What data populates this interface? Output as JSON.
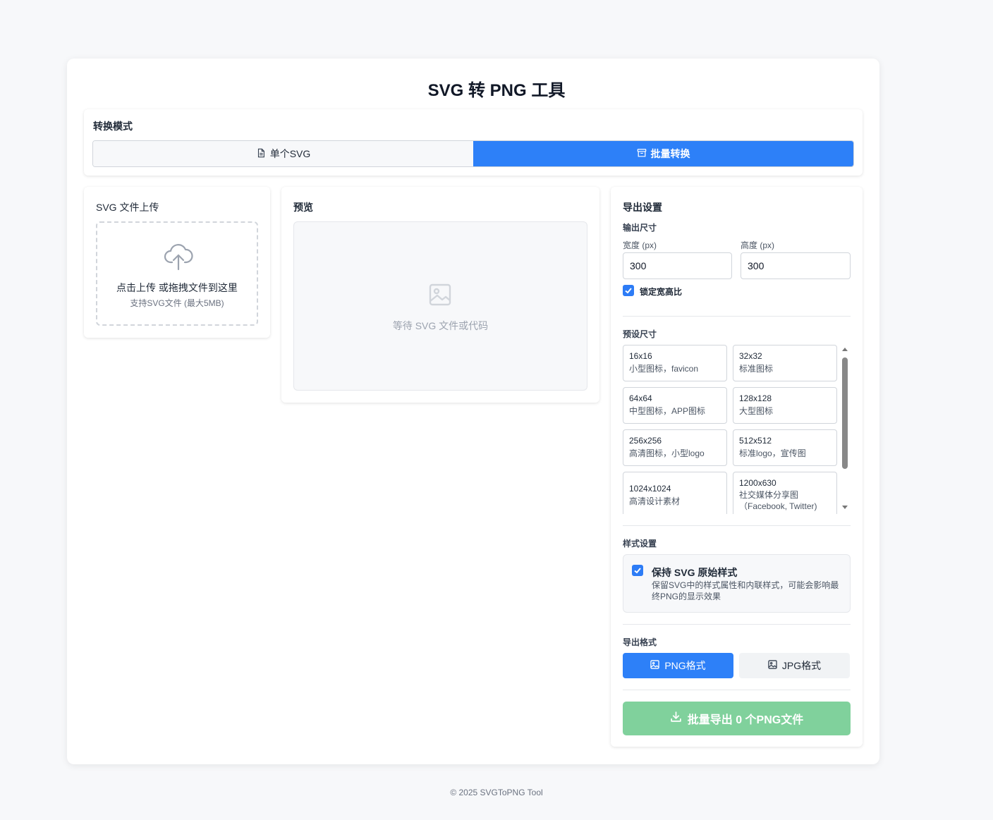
{
  "app": {
    "title": "SVG 转 PNG 工具",
    "footer": "© 2025 SVGToPNG Tool"
  },
  "mode": {
    "label": "转换模式",
    "single_label": "单个SVG",
    "batch_label": "批量转换",
    "selected": "batch"
  },
  "upload": {
    "title": "SVG 文件上传",
    "main_text": "点击上传 或拖拽文件到这里",
    "sub_text": "支持SVG文件 (最大5MB)"
  },
  "preview": {
    "title": "预览",
    "placeholder": "等待 SVG 文件或代码"
  },
  "export": {
    "title": "导出设置",
    "size_label": "输出尺寸",
    "width_label": "宽度 (px)",
    "height_label": "高度 (px)",
    "width_value": "300",
    "height_value": "300",
    "lock_label": "锁定宽高比",
    "lock_checked": true,
    "presets_label": "预设尺寸",
    "presets": [
      {
        "size": "16x16",
        "desc": "小型图标，favicon"
      },
      {
        "size": "32x32",
        "desc": "标准图标"
      },
      {
        "size": "64x64",
        "desc": "中型图标，APP图标"
      },
      {
        "size": "128x128",
        "desc": "大型图标"
      },
      {
        "size": "256x256",
        "desc": "高清图标，小型logo"
      },
      {
        "size": "512x512",
        "desc": "标准logo，宣传图"
      },
      {
        "size": "1024x1024",
        "desc": "高清设计素材"
      },
      {
        "size": "1200x630",
        "desc": "社交媒体分享图（Facebook, Twitter)"
      }
    ],
    "style_label": "样式设置",
    "keep_style_label": "保持 SVG 原始样式",
    "keep_style_desc": "保留SVG中的样式属性和内联样式，可能会影响最终PNG的显示效果",
    "keep_style_checked": true,
    "format_label": "导出格式",
    "png_label": "PNG格式",
    "jpg_label": "JPG格式",
    "selected_format": "PNG",
    "export_button": "批量导出 0 个PNG文件"
  },
  "colors": {
    "primary": "#2d80f8",
    "export_disabled": "#80d19c",
    "page_bg": "#f7f8fa"
  }
}
